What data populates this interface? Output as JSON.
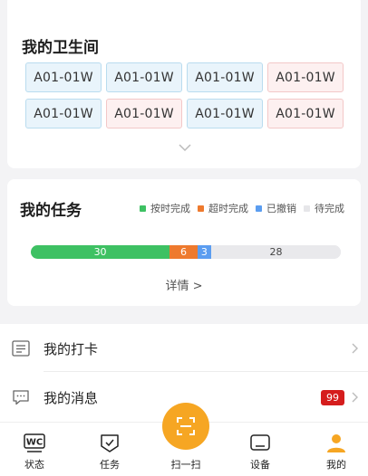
{
  "toilets": {
    "title": "我的卫生间",
    "cells": [
      {
        "label": "A01-01W",
        "tone": "blue"
      },
      {
        "label": "A01-01W",
        "tone": "blue"
      },
      {
        "label": "A01-01W",
        "tone": "blue"
      },
      {
        "label": "A01-01W",
        "tone": "pink"
      },
      {
        "label": "A01-01W",
        "tone": "blue"
      },
      {
        "label": "A01-01W",
        "tone": "pink"
      },
      {
        "label": "A01-01W",
        "tone": "blue"
      },
      {
        "label": "A01-01W",
        "tone": "pink"
      }
    ],
    "expand_icon": "chevron-down-icon"
  },
  "tasks": {
    "title": "我的任务",
    "legend": [
      {
        "label": "按时完成",
        "color": "#3ec163"
      },
      {
        "label": "超时完成",
        "color": "#ee7a2e"
      },
      {
        "label": "已撤销",
        "color": "#5b9df0"
      },
      {
        "label": "待完成",
        "color": "#e6e6e9"
      }
    ],
    "progress": [
      {
        "key": "ontime",
        "value": 30,
        "label": "30",
        "color": "#3ec163"
      },
      {
        "key": "overtime",
        "value": 6,
        "label": "6",
        "color": "#ee7a2e"
      },
      {
        "key": "cancelled",
        "value": 3,
        "label": "3",
        "color": "#5b9df0"
      },
      {
        "key": "pending",
        "value": 28,
        "label": "28",
        "color": "#e9e9ec"
      }
    ],
    "details_link": "详情 >"
  },
  "list": {
    "checkin": {
      "label": "我的打卡",
      "icon": "list-icon"
    },
    "messages": {
      "label": "我的消息",
      "icon": "chat-icon",
      "badge": "99"
    }
  },
  "tabbar": {
    "status": "状态",
    "task": "任务",
    "scan": "扫一扫",
    "device": "设备",
    "mine": "我的",
    "status_icon_text": "WC",
    "accent": "#f6a623"
  }
}
